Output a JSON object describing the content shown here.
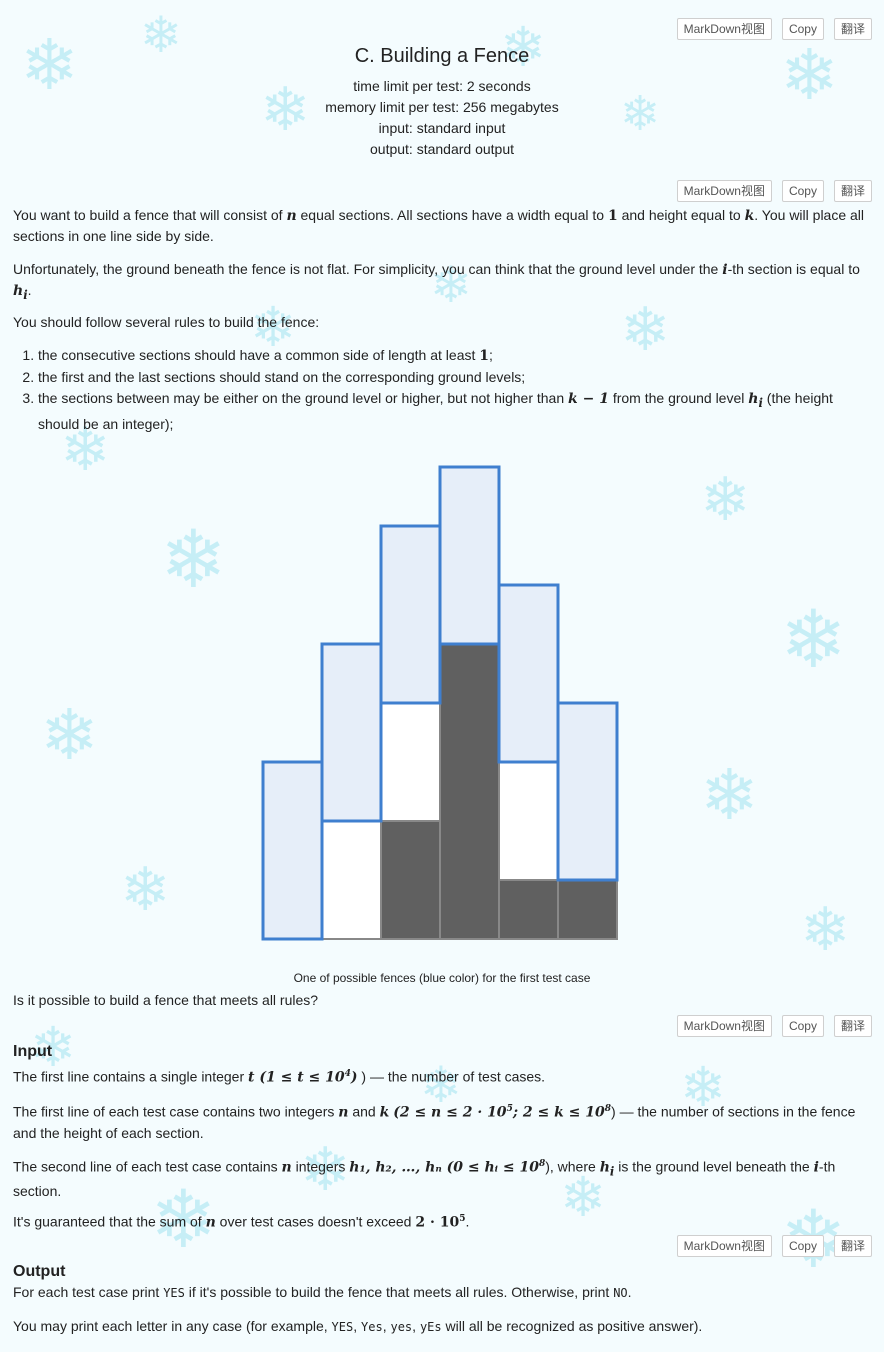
{
  "problem": {
    "title": "C. Building a Fence",
    "time_limit": "time limit per test: 2 seconds",
    "memory_limit": "memory limit per test: 256 megabytes",
    "input": "input: standard input",
    "output": "output: standard output"
  },
  "toolbar": {
    "markdown": "MarkDown视图",
    "copy": "Copy",
    "translate": "翻译"
  },
  "statement": {
    "p1_a": "You want to build a fence that will consist of",
    "p1_b": "equal sections. All sections have a width equal to",
    "p1_c": "and height equal to",
    "p1_d": ". You will place all sections in one line side by side.",
    "p2_a": "Unfortunately, the ground beneath the fence is not flat. For simplicity, you can think that the ground level under the",
    "p2_b": "-th section is equal to",
    "p3": "You should follow several rules to build the fence:",
    "rule1": "the consecutive sections should have a common side of length at least",
    "rule2": "the first and the last sections should stand on the corresponding ground levels;",
    "rule3_a": "the sections between may be either on the ground level or higher, but not higher than",
    "rule3_b": "from the ground level",
    "rule3_c": "(the height should be an integer);",
    "caption": "One of possible fences (blue color) for the first test case",
    "question": "Is it possible to build a fence that meets all rules?"
  },
  "math": {
    "n": "n",
    "one": "1",
    "k": "k",
    "i": "i",
    "hi": "h",
    "hi_sub": "i",
    "k_minus_1": "k − 1",
    "t": "t"
  },
  "input_section": {
    "heading": "Input",
    "l1_a": "The first line contains a single integer",
    "l1_math": "t (1 ≤ t ≤ 10",
    "l1_sup": "4",
    "l1_b": ") — the number of test cases.",
    "l2_a": "The first line of each test case contains two integers",
    "l2_math": "(2 ≤ n ≤ 2 · 10",
    "l2_sup1": "5",
    "l2_math2": "; 2 ≤ k ≤ 10",
    "l2_sup2": "8",
    "l2_b": ") — the number of sections in the fence and the height of each section.",
    "l3_a": "The second line of each test case contains",
    "l3_b": "integers",
    "l3_math": "h₁, h₂, …, hₙ (0 ≤ hᵢ ≤ 10",
    "l3_sup": "8",
    "l3_c": "), where",
    "l3_d": "is the ground level beneath the",
    "l3_e": "-th section.",
    "l4_a": "It's guaranteed that the sum of",
    "l4_b": "over test cases doesn't exceed",
    "l4_math": "2 · 10",
    "l4_sup": "5",
    "l4_c": "."
  },
  "output_section": {
    "heading": "Output",
    "l1_a": "For each test case print",
    "yes": "YES",
    "l1_b": "if it's possible to build the fence that meets all rules. Otherwise, print",
    "no": "NO",
    "l2_a": "You may print each letter in any case (for example,",
    "v1": "YES",
    "v2": "Yes",
    "v3": "yes",
    "v4": "yEs",
    "l2_b": "will all be recognized as positive answer)."
  },
  "figure": {
    "ground_levels": [
      0,
      0,
      2,
      5,
      1,
      1
    ],
    "section_bottoms": [
      0,
      2,
      4,
      5,
      3,
      1
    ],
    "k": 3,
    "colors": {
      "fence_fill": "#e6eef9",
      "fence_stroke": "#3f7fcf",
      "ground": "#606060",
      "outline": "#888888"
    }
  }
}
